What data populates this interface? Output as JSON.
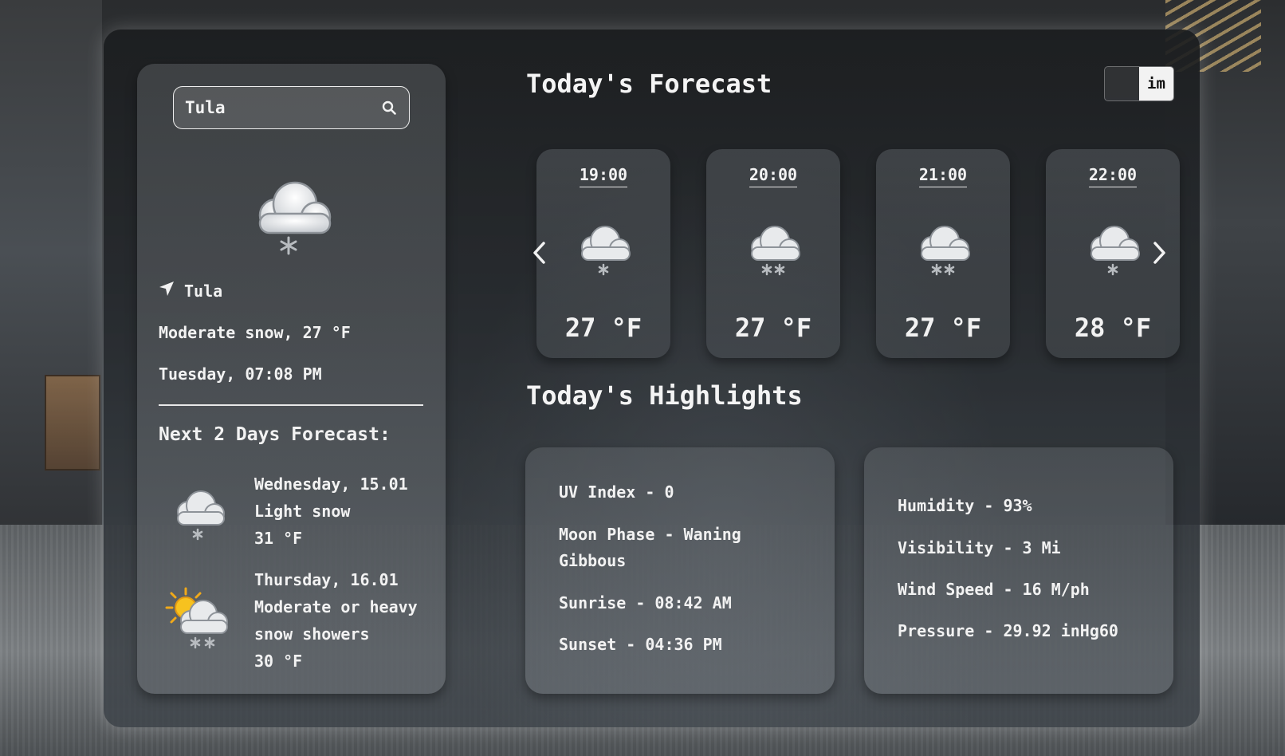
{
  "search": {
    "value": "Tula"
  },
  "current": {
    "icon": "snow-cloud-icon",
    "city": "Tula",
    "condition": "Moderate snow, 27 °F",
    "datetime": "Tuesday, 07:08 PM"
  },
  "next_days": {
    "title": "Next 2 Days Forecast:",
    "days": [
      {
        "date": "Wednesday, 15.01",
        "condition": "Light snow",
        "temp": "31 °F",
        "icon": "light-snow-icon"
      },
      {
        "date": "Thursday, 16.01",
        "condition_line1": "Moderate or heavy",
        "condition_line2": "snow showers",
        "temp": "30 °F",
        "icon": "sun-cloud-snow-icon"
      }
    ]
  },
  "forecast": {
    "title": "Today's Forecast",
    "toggle_label": "im",
    "hours": [
      {
        "time": "19:00",
        "temp": "27 °F",
        "icon": "light-snow-icon"
      },
      {
        "time": "20:00",
        "temp": "27 °F",
        "icon": "moderate-snow-icon"
      },
      {
        "time": "21:00",
        "temp": "27 °F",
        "icon": "moderate-snow-icon"
      },
      {
        "time": "22:00",
        "temp": "28 °F",
        "icon": "light-snow-icon"
      }
    ]
  },
  "highlights": {
    "title": "Today's Highlights",
    "left": {
      "uv": "UV Index - 0",
      "moon_line1": "Moon Phase - Waning",
      "moon_line2": "Gibbous",
      "sunrise": "Sunrise - 08:42 AM",
      "sunset": "Sunset - 04:36 PM"
    },
    "right": {
      "humidity": "Humidity - 93%",
      "visibility": "Visibility - 3 Mi",
      "wind": "Wind Speed - 16 M/ph",
      "pressure": "Pressure - 29.92 inHg60"
    }
  }
}
